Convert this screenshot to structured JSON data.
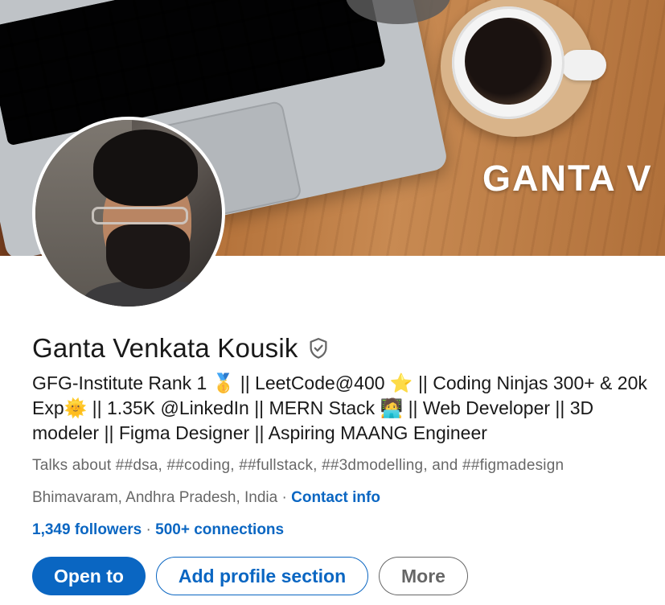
{
  "banner": {
    "text": "GANTA V"
  },
  "profile": {
    "name": "Ganta Venkata Kousik",
    "verified_icon": "verified-shield-icon",
    "headline": "GFG-Institute Rank 1 🥇 || LeetCode@400 ⭐ || Coding Ninjas 300+ & 20k Exp🌞 || 1.35K @LinkedIn || MERN Stack 🧑‍💻 || Web Developer || 3D modeler || Figma Designer || Aspiring MAANG Engineer",
    "talks_about": "Talks about ##dsa, ##coding, ##fullstack, ##3dmodelling, and ##figmadesign",
    "location": "Bhimavaram, Andhra Pradesh, India",
    "location_separator": " · ",
    "contact_info_label": "Contact info",
    "followers_label": "1,349 followers",
    "stats_separator": " · ",
    "connections_label": "500+ connections"
  },
  "actions": {
    "open_to_label": "Open to",
    "add_section_label": "Add profile section",
    "more_label": "More"
  },
  "colors": {
    "accent": "#0a66c2",
    "text_primary": "rgba(0,0,0,0.9)",
    "text_secondary": "rgba(0,0,0,0.6)"
  }
}
